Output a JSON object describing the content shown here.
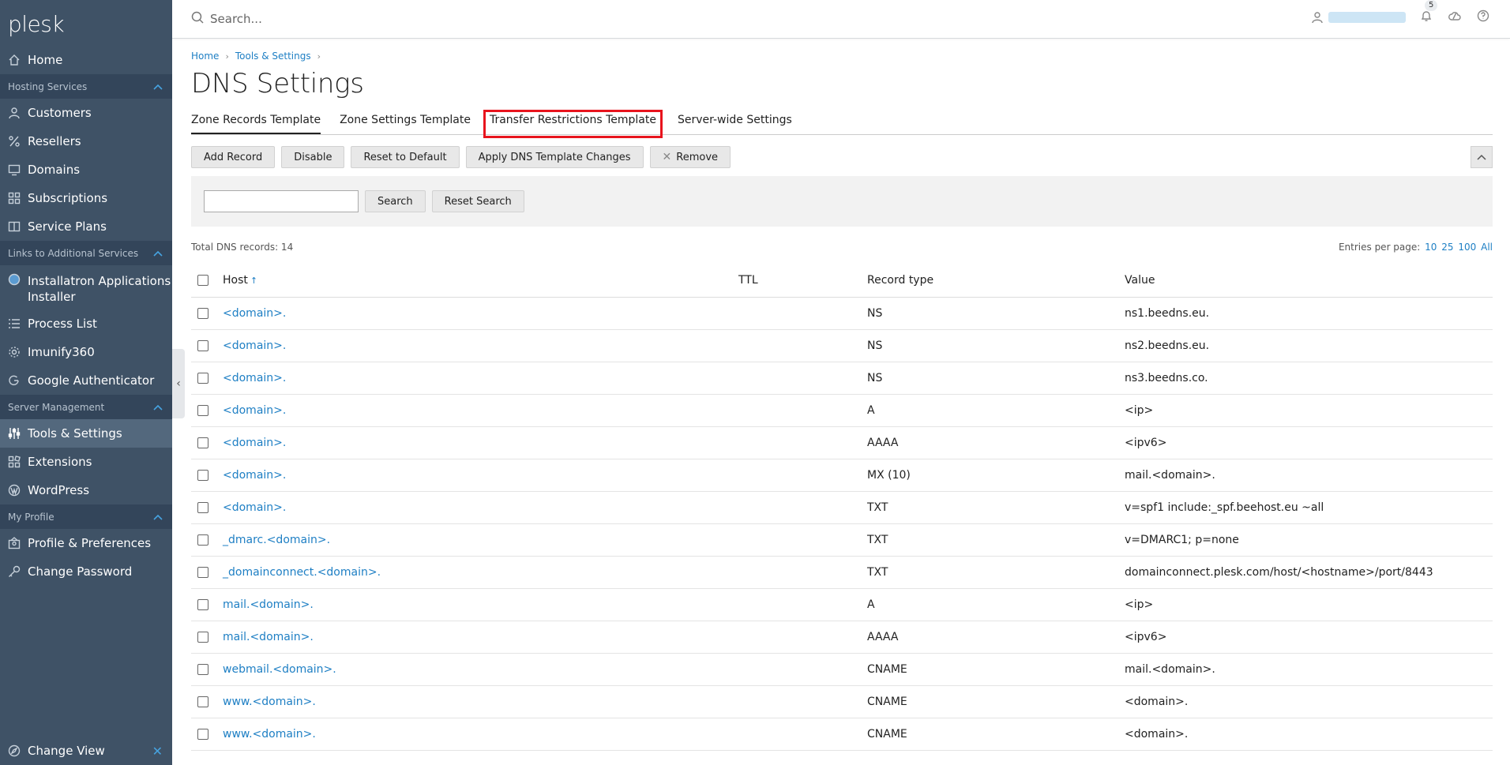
{
  "logo": "plesk",
  "sidebar": {
    "home": "Home",
    "sections": {
      "hosting": "Hosting Services",
      "links": "Links to Additional Services",
      "server": "Server Management",
      "profile": "My Profile"
    },
    "hosting_items": [
      "Customers",
      "Resellers",
      "Domains",
      "Subscriptions",
      "Service Plans"
    ],
    "links_items": [
      "Installatron Applications Installer",
      "Process List",
      "Imunify360",
      "Google Authenticator"
    ],
    "server_items": [
      "Tools & Settings",
      "Extensions",
      "WordPress"
    ],
    "profile_items": [
      "Profile & Preferences",
      "Change Password"
    ],
    "change_view": "Change View"
  },
  "topbar": {
    "search_placeholder": "Search...",
    "notifications_count": "5"
  },
  "breadcrumb": [
    "Home",
    "Tools & Settings"
  ],
  "page_title": "DNS Settings",
  "tabs": [
    "Zone Records Template",
    "Zone Settings Template",
    "Transfer Restrictions Template",
    "Server-wide Settings"
  ],
  "toolbar": {
    "add_record": "Add Record",
    "disable": "Disable",
    "reset_default": "Reset to Default",
    "apply_changes": "Apply DNS Template Changes",
    "remove": "Remove"
  },
  "search_panel": {
    "search": "Search",
    "reset": "Reset Search"
  },
  "list": {
    "total": "Total DNS records: 14",
    "entries_label": "Entries per page:",
    "entries_options": [
      "10",
      "25",
      "100",
      "All"
    ]
  },
  "table": {
    "headers": {
      "host": "Host",
      "ttl": "TTL",
      "type": "Record type",
      "value": "Value"
    },
    "rows": [
      {
        "host": "<domain>.",
        "ttl": "",
        "type": "NS",
        "value": "ns1.beedns.eu."
      },
      {
        "host": "<domain>.",
        "ttl": "",
        "type": "NS",
        "value": "ns2.beedns.eu."
      },
      {
        "host": "<domain>.",
        "ttl": "",
        "type": "NS",
        "value": "ns3.beedns.co."
      },
      {
        "host": "<domain>.",
        "ttl": "",
        "type": "A",
        "value": "<ip>"
      },
      {
        "host": "<domain>.",
        "ttl": "",
        "type": "AAAA",
        "value": "<ipv6>"
      },
      {
        "host": "<domain>.",
        "ttl": "",
        "type": "MX (10)",
        "value": "mail.<domain>."
      },
      {
        "host": "<domain>.",
        "ttl": "",
        "type": "TXT",
        "value": "v=spf1 include:_spf.beehost.eu ~all"
      },
      {
        "host": "_dmarc.<domain>.",
        "ttl": "",
        "type": "TXT",
        "value": "v=DMARC1; p=none"
      },
      {
        "host": "_domainconnect.<domain>.",
        "ttl": "",
        "type": "TXT",
        "value": "domainconnect.plesk.com/host/<hostname>/port/8443"
      },
      {
        "host": "mail.<domain>.",
        "ttl": "",
        "type": "A",
        "value": "<ip>"
      },
      {
        "host": "mail.<domain>.",
        "ttl": "",
        "type": "AAAA",
        "value": "<ipv6>"
      },
      {
        "host": "webmail.<domain>.",
        "ttl": "",
        "type": "CNAME",
        "value": "mail.<domain>."
      },
      {
        "host": "www.<domain>.",
        "ttl": "",
        "type": "CNAME",
        "value": "<domain>."
      },
      {
        "host": "www.<domain>.",
        "ttl": "",
        "type": "CNAME",
        "value": "<domain>."
      }
    ]
  },
  "colors": {
    "sidebar_bg": "#3f5266",
    "sidebar_section_bg": "#33455a",
    "link": "#1e7fc4",
    "highlight": "#e8141d"
  }
}
